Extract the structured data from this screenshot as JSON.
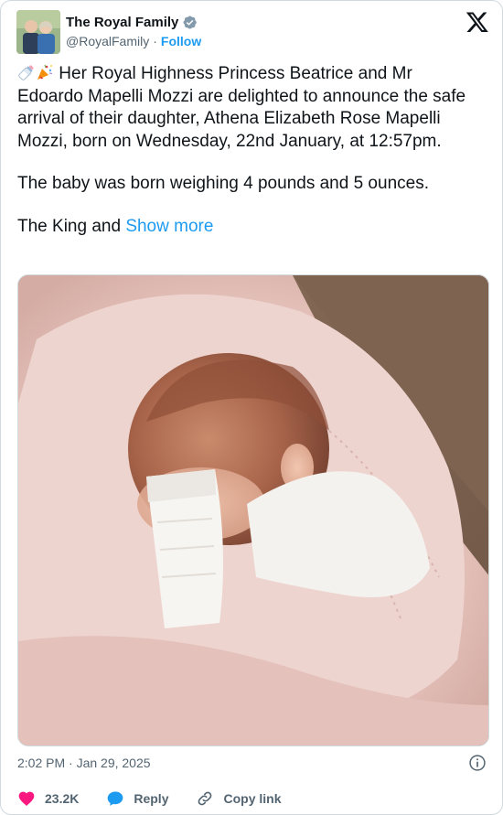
{
  "author": {
    "name": "The Royal Family",
    "handle": "@RoyalFamily",
    "separator": "·",
    "follow_label": "Follow"
  },
  "icons": {
    "avatar": "royal-family-avatar",
    "verified": "verified-badge-icon",
    "x_logo": "x-logo-icon",
    "info": "info-icon",
    "like": "heart-icon",
    "reply": "reply-bubble-icon",
    "copy_link": "link-icon"
  },
  "tweet": {
    "paragraph1": "Her Royal Highness Princess Beatrice and Mr Edoardo Mapelli Mozzi are delighted to announce the safe arrival of their daughter, Athena Elizabeth Rose Mapelli Mozzi, born on Wednesday, 22nd January, at 12:57pm.",
    "paragraph2": "The baby was born weighing 4 pounds and 5 ounces.",
    "paragraph3": "The King and",
    "show_more": "Show more"
  },
  "media": {
    "alt": "photo"
  },
  "meta": {
    "timestamp": "2:02 PM · Jan 29, 2025"
  },
  "actions": {
    "likes": "23.2K",
    "reply_label": "Reply",
    "copy_link_label": "Copy link"
  },
  "colors": {
    "accent": "#1d9bf0",
    "like": "#f91880",
    "secondary_text": "#536471"
  }
}
